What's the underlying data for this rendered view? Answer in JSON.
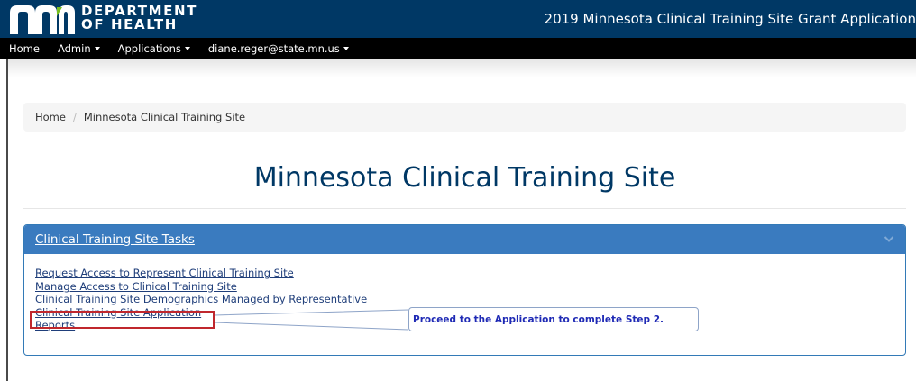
{
  "header": {
    "dept_line1": "DEPARTMENT",
    "dept_line2": "OF HEALTH",
    "app_title": "2019 Minnesota Clinical Training Site Grant Application",
    "brand_color": "#003865"
  },
  "nav": {
    "items": [
      {
        "label": "Home",
        "has_dropdown": false
      },
      {
        "label": "Admin",
        "has_dropdown": true
      },
      {
        "label": "Applications",
        "has_dropdown": true
      },
      {
        "label": "diane.reger@state.mn.us",
        "has_dropdown": true
      }
    ]
  },
  "breadcrumb": {
    "home": "Home",
    "current": "Minnesota Clinical Training Site"
  },
  "page": {
    "title": "Minnesota Clinical Training Site"
  },
  "panel": {
    "heading": "Clinical Training Site Tasks",
    "heading_color": "#3a7bbf",
    "links": [
      "Request Access to Represent Clinical Training Site",
      "Manage Access to Clinical Training Site",
      "Clinical Training Site Demographics Managed by Representative",
      "Clinical Training Site Application",
      "Reports"
    ]
  },
  "annotation": {
    "callout_text": "Proceed to the Application to complete Step 2.",
    "highlight_color": "#c0272d"
  }
}
